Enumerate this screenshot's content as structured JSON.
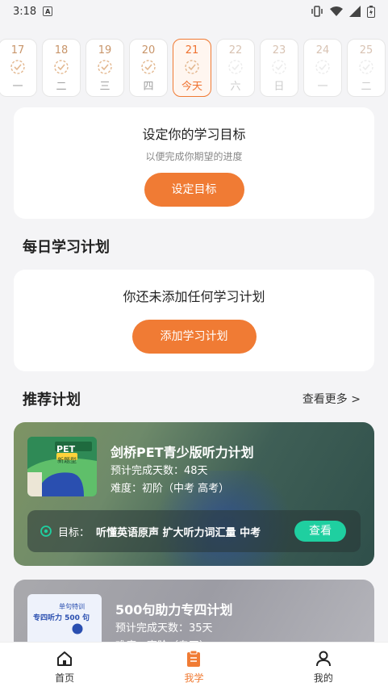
{
  "status": {
    "time": "3:18",
    "a_icon_label": "A"
  },
  "days": [
    {
      "num": "17",
      "wk": "一",
      "state": "normal"
    },
    {
      "num": "18",
      "wk": "二",
      "state": "normal"
    },
    {
      "num": "19",
      "wk": "三",
      "state": "normal"
    },
    {
      "num": "20",
      "wk": "四",
      "state": "normal"
    },
    {
      "num": "21",
      "wk": "今天",
      "state": "today"
    },
    {
      "num": "22",
      "wk": "六",
      "state": "faded"
    },
    {
      "num": "23",
      "wk": "日",
      "state": "faded"
    },
    {
      "num": "24",
      "wk": "一",
      "state": "faded"
    },
    {
      "num": "25",
      "wk": "二",
      "state": "faded"
    }
  ],
  "goal": {
    "title": "设定你的学习目标",
    "subtitle": "以便完成你期望的进度",
    "button": "设定目标"
  },
  "daily": {
    "section_title": "每日学习计划",
    "empty_text": "你还未添加任何学习计划",
    "button": "添加学习计划"
  },
  "recommend": {
    "section_title": "推荐计划",
    "more": "查看更多 >",
    "items": [
      {
        "title": "剑桥PET青少版听力计划",
        "days": "预计完成天数：48天",
        "level": "难度：初阶（中考 高考）",
        "goal_label": "目标：",
        "goal_text": "听懂英语原声 扩大听力词汇量 中考",
        "view": "查看",
        "thumb_top": "PET",
        "thumb_badge": "新题型"
      },
      {
        "title": "500句助力专四计划",
        "days": "预计完成天数：35天",
        "level": "难度：高阶（专四）",
        "thumb_top": "单句特训",
        "thumb_title": "专四听力 500 句"
      }
    ]
  },
  "tabs": [
    {
      "label": "首页"
    },
    {
      "label": "我学"
    },
    {
      "label": "我的"
    }
  ],
  "colors": {
    "accent": "#f07b34",
    "teal": "#1fcfa0"
  }
}
